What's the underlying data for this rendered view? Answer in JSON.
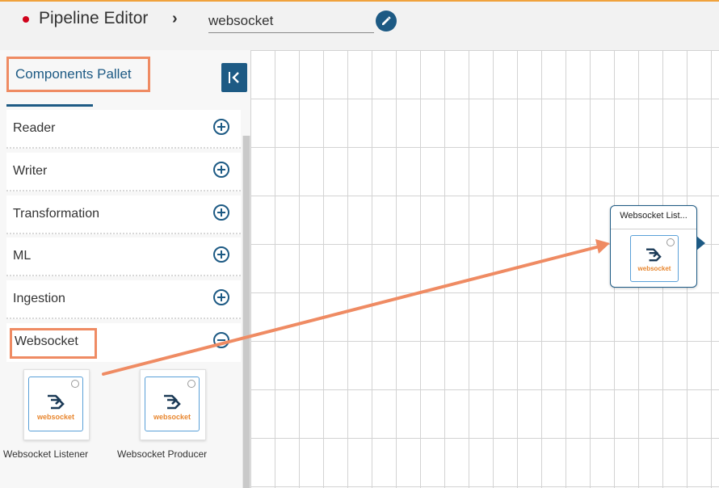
{
  "header": {
    "app_title": "Pipeline Editor",
    "breadcrumb_separator": "›",
    "pipeline_name": "websocket",
    "edit_icon": "pencil-icon",
    "status_color": "#d0021b"
  },
  "sidebar": {
    "title": "Components Pallet",
    "collapse_icon": "collapse-left-icon",
    "categories": [
      {
        "label": "Reader",
        "state": "collapsed"
      },
      {
        "label": "Writer",
        "state": "collapsed"
      },
      {
        "label": "Transformation",
        "state": "collapsed"
      },
      {
        "label": "ML",
        "state": "collapsed"
      },
      {
        "label": "Ingestion",
        "state": "collapsed"
      },
      {
        "label": "Websocket",
        "state": "expanded"
      }
    ],
    "components": [
      {
        "label": "Websocket Listener",
        "icon": "websocket-icon",
        "logo_text": "websocket"
      },
      {
        "label": "Websocket Producer",
        "icon": "websocket-icon",
        "logo_text": "websocket"
      }
    ]
  },
  "canvas": {
    "node": {
      "title": "Websocket List...",
      "icon": "websocket-icon",
      "logo_text": "websocket"
    }
  },
  "colors": {
    "accent": "#1d5a84",
    "highlight": "#ef8b63",
    "logo_orange": "#e8862e"
  }
}
